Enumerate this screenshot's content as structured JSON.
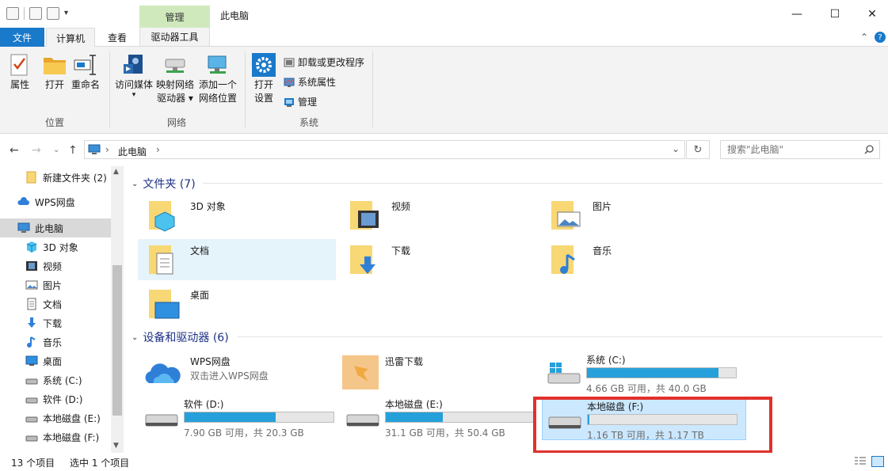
{
  "titlebar": {
    "title": "此电脑",
    "context_tab_header": "管理"
  },
  "tabs": {
    "file": "文件",
    "computer": "计算机",
    "view": "查看",
    "drive_tools": "驱动器工具"
  },
  "ribbon": {
    "location": {
      "label": "位置",
      "properties": "属性",
      "open": "打开",
      "rename": "重命名"
    },
    "network": {
      "label": "网络",
      "access_media_1": "访问媒体",
      "map_drive_1": "映射网络",
      "map_drive_2": "驱动器 ▾",
      "add_location_1": "添加一个",
      "add_location_2": "网络位置"
    },
    "system": {
      "label": "系统",
      "open_settings_1": "打开",
      "open_settings_2": "设置",
      "uninstall": "卸载或更改程序",
      "system_properties": "系统属性",
      "manage": "管理"
    }
  },
  "address": {
    "crumb": "此电脑",
    "search_placeholder": "搜索\"此电脑\""
  },
  "sidebar": {
    "items": [
      {
        "label": "新建文件夹 (2)"
      },
      {
        "label": "WPS网盘"
      },
      {
        "label": "此电脑"
      },
      {
        "label": "3D 对象"
      },
      {
        "label": "视频"
      },
      {
        "label": "图片"
      },
      {
        "label": "文档"
      },
      {
        "label": "下载"
      },
      {
        "label": "音乐"
      },
      {
        "label": "桌面"
      },
      {
        "label": "系统 (C:)"
      },
      {
        "label": "软件 (D:)"
      },
      {
        "label": "本地磁盘 (E:)"
      },
      {
        "label": "本地磁盘 (F:)"
      }
    ]
  },
  "folders": {
    "header": "文件夹 (7)",
    "items": [
      {
        "name": "3D 对象"
      },
      {
        "name": "视频"
      },
      {
        "name": "图片"
      },
      {
        "name": "文档"
      },
      {
        "name": "下载"
      },
      {
        "name": "音乐"
      },
      {
        "name": "桌面"
      }
    ]
  },
  "devices": {
    "header": "设备和驱动器 (6)",
    "wps": {
      "name": "WPS网盘",
      "subtitle": "双击进入WPS网盘"
    },
    "xunlei": {
      "name": "迅雷下载"
    },
    "drives": [
      {
        "name": "系统 (C:)",
        "info": "4.66 GB 可用，共 40.0 GB",
        "used_fraction": 0.884
      },
      {
        "name": "软件 (D:)",
        "info": "7.90 GB 可用，共 20.3 GB",
        "used_fraction": 0.611
      },
      {
        "name": "本地磁盘 (E:)",
        "info": "31.1 GB 可用，共 50.4 GB",
        "used_fraction": 0.383
      },
      {
        "name": "本地磁盘 (F:)",
        "info": "1.16 TB 可用，共 1.17 TB",
        "used_fraction": 0.009
      }
    ]
  },
  "status": {
    "count": "13 个项目",
    "selected": "选中 1 个项目"
  },
  "colors": {
    "accent": "#1979ca",
    "drive_bar": "#26a0da",
    "highlight": "#e0312b",
    "context_tab": "#cfe9bd"
  }
}
